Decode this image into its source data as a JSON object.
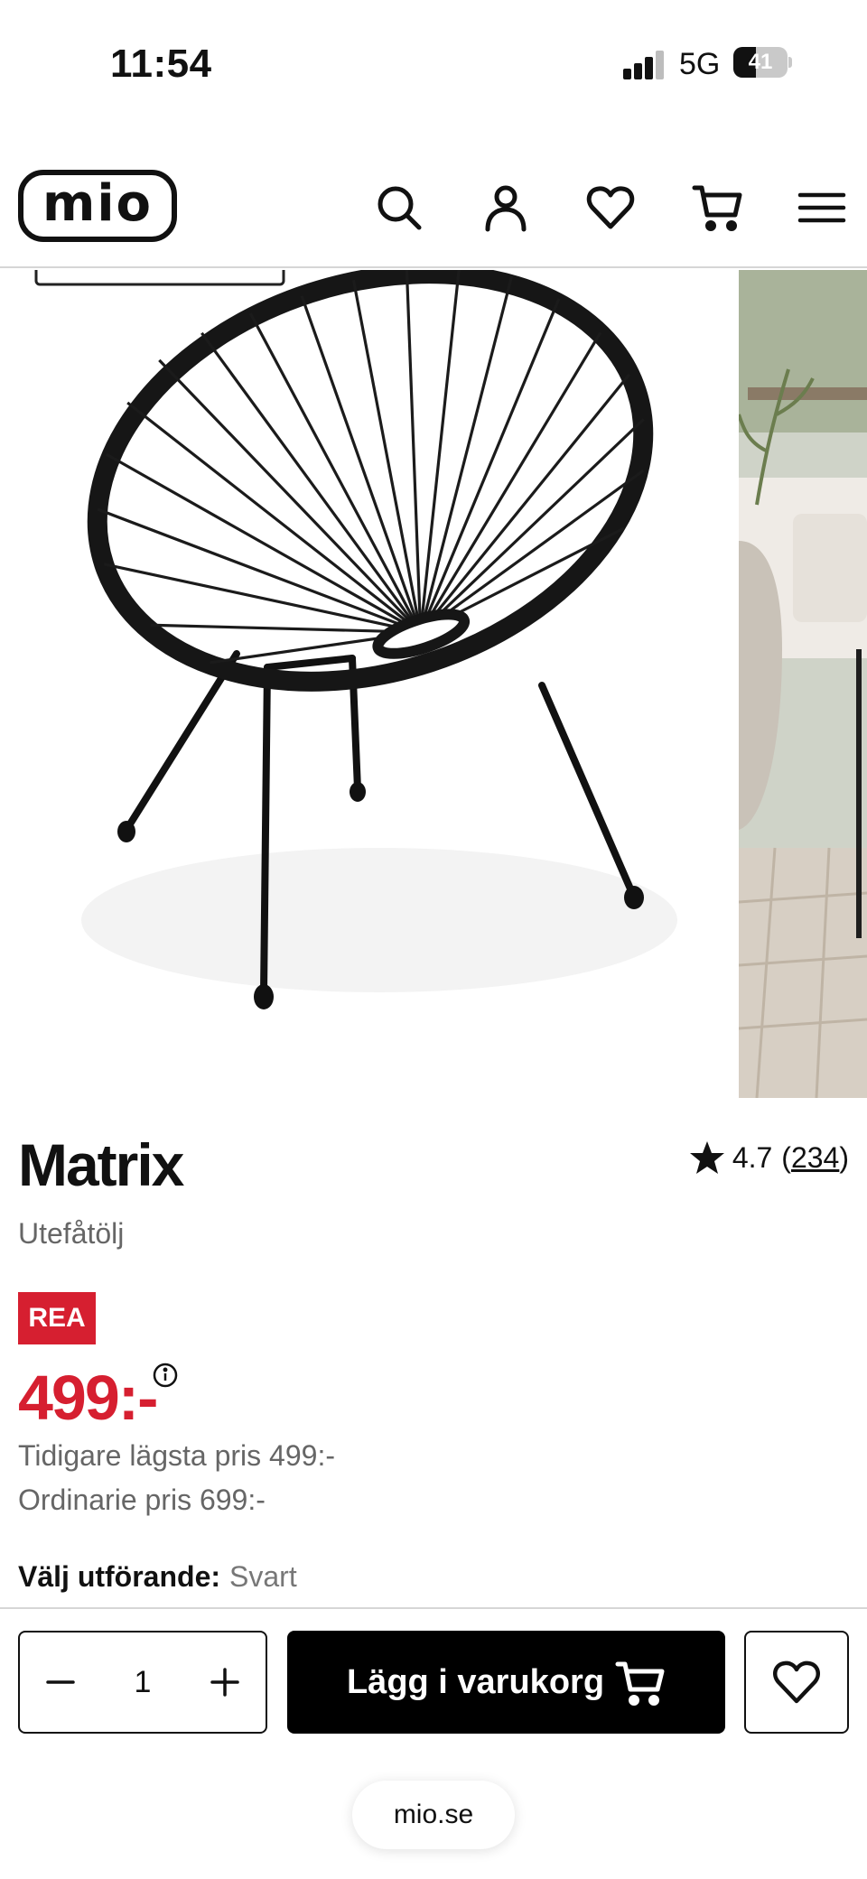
{
  "status_bar": {
    "time": "11:54",
    "network": "5G",
    "battery": "41",
    "battery_level": 0.41
  },
  "header": {
    "logo_text": "mio",
    "icons": [
      "search-icon",
      "account-icon",
      "heart-icon",
      "cart-icon",
      "menu-icon"
    ]
  },
  "product": {
    "name": "Matrix",
    "category": "Utefåtölj",
    "rating": "4.7",
    "review_count_open": "(",
    "review_count": "234",
    "review_count_close": ")",
    "sale_badge": "REA",
    "price": "499:-",
    "previous_lowest_price": "Tidigare lägsta pris 499:-",
    "regular_price": "Ordinarie pris 699:-",
    "variant_label": "Välj utförande:",
    "variant_value": "Svart"
  },
  "bottom_bar": {
    "quantity": "1",
    "add_to_cart_label": "Lägg i varukorg",
    "url": "mio.se"
  },
  "colors": {
    "sale_red": "#d61f30",
    "primary_black": "#000000",
    "muted_text": "#666666"
  }
}
